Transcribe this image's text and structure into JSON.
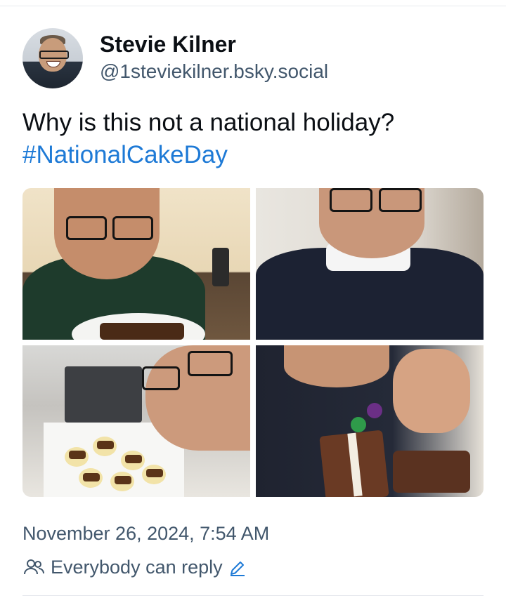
{
  "author": {
    "display_name": "Stevie Kilner",
    "handle": "@1steviekilner.bsky.social",
    "avatar_icon": "avatar-photo"
  },
  "post": {
    "text": "Why is this not a national holiday?",
    "hashtag": "#NationalCakeDay"
  },
  "media": {
    "images": [
      {
        "name": "photo-man-with-cake-on-plate"
      },
      {
        "name": "photo-man-smiling-in-jumper"
      },
      {
        "name": "photo-box-of-cupcakes"
      },
      {
        "name": "photo-thumbs-up-with-cake-slice"
      }
    ]
  },
  "meta": {
    "timestamp": "November 26, 2024, 7:54 AM",
    "reply_setting": "Everybody can reply",
    "icons": [
      "people-icon",
      "pencil-icon"
    ]
  },
  "colors": {
    "link": "#1e7ad6",
    "muted_text": "#42576c",
    "divider": "#e6e9ee"
  }
}
